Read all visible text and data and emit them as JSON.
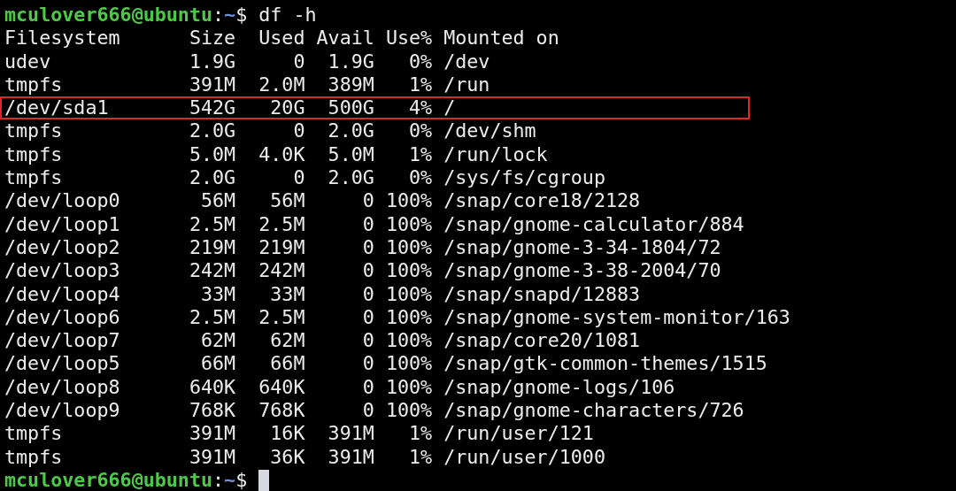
{
  "lines": [
    {
      "kind": "prompt",
      "user_host": "mculover666@ubuntu",
      "sep": ":",
      "path": "~",
      "symbol": "$",
      "command": "df -h",
      "cursor": false
    },
    {
      "kind": "output",
      "text": "Filesystem      Size  Used Avail Use% Mounted on",
      "highlighted": false
    },
    {
      "kind": "output",
      "text": "udev            1.9G     0  1.9G   0% /dev",
      "highlighted": false
    },
    {
      "kind": "output",
      "text": "tmpfs           391M  2.0M  389M   1% /run",
      "highlighted": false
    },
    {
      "kind": "output",
      "text": "/dev/sda1       542G   20G  500G   4% /",
      "highlighted": true
    },
    {
      "kind": "output",
      "text": "tmpfs           2.0G     0  2.0G   0% /dev/shm",
      "highlighted": false
    },
    {
      "kind": "output",
      "text": "tmpfs           5.0M  4.0K  5.0M   1% /run/lock",
      "highlighted": false
    },
    {
      "kind": "output",
      "text": "tmpfs           2.0G     0  2.0G   0% /sys/fs/cgroup",
      "highlighted": false
    },
    {
      "kind": "output",
      "text": "/dev/loop0       56M   56M     0 100% /snap/core18/2128",
      "highlighted": false
    },
    {
      "kind": "output",
      "text": "/dev/loop1      2.5M  2.5M     0 100% /snap/gnome-calculator/884",
      "highlighted": false
    },
    {
      "kind": "output",
      "text": "/dev/loop2      219M  219M     0 100% /snap/gnome-3-34-1804/72",
      "highlighted": false
    },
    {
      "kind": "output",
      "text": "/dev/loop3      242M  242M     0 100% /snap/gnome-3-38-2004/70",
      "highlighted": false
    },
    {
      "kind": "output",
      "text": "/dev/loop4       33M   33M     0 100% /snap/snapd/12883",
      "highlighted": false
    },
    {
      "kind": "output",
      "text": "/dev/loop6      2.5M  2.5M     0 100% /snap/gnome-system-monitor/163",
      "highlighted": false
    },
    {
      "kind": "output",
      "text": "/dev/loop7       62M   62M     0 100% /snap/core20/1081",
      "highlighted": false
    },
    {
      "kind": "output",
      "text": "/dev/loop5       66M   66M     0 100% /snap/gtk-common-themes/1515",
      "highlighted": false
    },
    {
      "kind": "output",
      "text": "/dev/loop8      640K  640K     0 100% /snap/gnome-logs/106",
      "highlighted": false
    },
    {
      "kind": "output",
      "text": "/dev/loop9      768K  768K     0 100% /snap/gnome-characters/726",
      "highlighted": false
    },
    {
      "kind": "output",
      "text": "tmpfs           391M   16K  391M   1% /run/user/121",
      "highlighted": false
    },
    {
      "kind": "output",
      "text": "tmpfs           391M   36K  391M   1% /run/user/1000",
      "highlighted": false
    },
    {
      "kind": "prompt",
      "user_host": "mculover666@ubuntu",
      "sep": ":",
      "path": "~",
      "symbol": "$",
      "cursor": true
    }
  ]
}
